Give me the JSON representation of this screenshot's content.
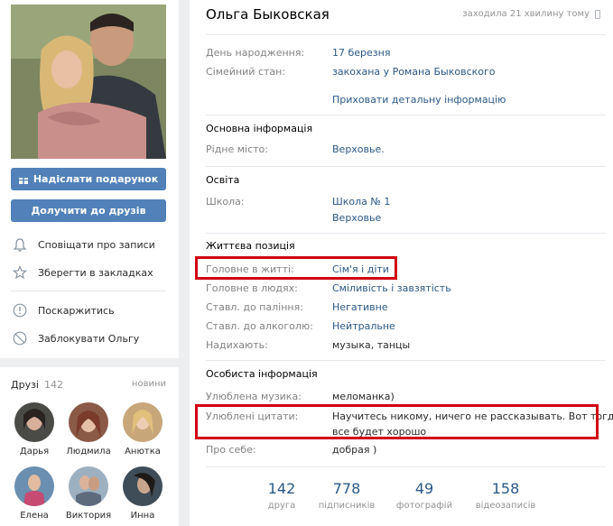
{
  "profile": {
    "name": "Ольга Быковская",
    "online": "заходила 21 хвилину тому"
  },
  "left": {
    "gift_button": "Надіслати подарунок",
    "friend_button": "Долучити до друзів",
    "actions": [
      {
        "label": "Сповіщати про записи",
        "icon": "bell-icon"
      },
      {
        "label": "Зберегти в закладках",
        "icon": "star-icon"
      },
      {
        "label": "Поскаржитись",
        "icon": "warning-icon"
      },
      {
        "label": "Заблокувати Ольгу",
        "icon": "block-icon"
      }
    ]
  },
  "friends": {
    "title": "Друзі",
    "count": "142",
    "new_label": "новини",
    "items": [
      {
        "name": "Дарья",
        "color": "#4a4a46"
      },
      {
        "name": "Людмила",
        "color": "#8a5a47"
      },
      {
        "name": "Анютка",
        "color": "#c7a67a"
      },
      {
        "name": "Елена",
        "color": "#6b8fb0"
      },
      {
        "name": "Виктория",
        "color": "#5e6b7d"
      },
      {
        "name": "Инна",
        "color": "#3f4d58"
      }
    ]
  },
  "info": {
    "birthday_label": "День народження:",
    "birthday_value": "17 березня",
    "family_label": "Сімейний стан:",
    "family_value": "закохана у Романа Быковского",
    "hide_details": "Приховати детальну інформацію",
    "main_title": "Основна інформація",
    "hometown_label": "Рідне місто:",
    "hometown_value": "Верховье.",
    "education_title": "Освіта",
    "school_label": "Школа:",
    "school_value": "Школа № 1",
    "school_city": "Верховье",
    "position_title": "Життєва позиція",
    "main_life_label": "Головне в житті:",
    "main_life_value": "Сім'я і діти",
    "main_people_label": "Головне в людях:",
    "main_people_value": "Сміливість і завзятість",
    "smoking_label": "Ставл. до паління:",
    "smoking_value": "Негативне",
    "alcohol_label": "Ставл. до алкоголю:",
    "alcohol_value": "Нейтральне",
    "inspire_label": "Надихають:",
    "inspire_value": "музыка, танцы",
    "personal_title": "Особиста інформація",
    "music_label": "Улюблена музика:",
    "music_value": "меломанка)",
    "quotes_label": "Улюблені цитати:",
    "quotes_line1": "Научитесь никому, ничего не рассказывать. Вот тогда",
    "quotes_line2": "все будет хорошо",
    "about_label": "Про себе:",
    "about_value": "добрая )"
  },
  "counters": [
    {
      "num": "142",
      "label": "друга"
    },
    {
      "num": "778",
      "label": "підписників"
    },
    {
      "num": "49",
      "label": "фотографій"
    },
    {
      "num": "158",
      "label": "відеозаписів"
    }
  ],
  "colors": {
    "accent": "#5181b8",
    "link": "#2a5885",
    "highlight": "#d10012",
    "background": "#edeef0"
  }
}
